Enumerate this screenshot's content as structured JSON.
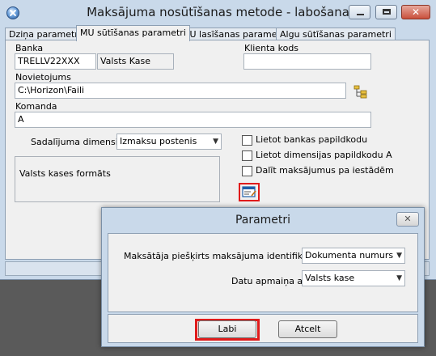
{
  "window": {
    "title": "Maksājuma nosūtīšanas metode - labošana",
    "minimize_label": "minimize",
    "maximize_label": "maximize",
    "close_glyph": "✕"
  },
  "tabs": [
    {
      "label": "Dziņa parametri"
    },
    {
      "label": "MU sūtīšanas parametri",
      "active": true
    },
    {
      "label": "MU lasīšanas parametri"
    },
    {
      "label": "Algu sūtīšanas parametri"
    }
  ],
  "form": {
    "bank_label": "Banka",
    "bank_code": "TRELLV22XXX",
    "bank_name": "Valsts Kase",
    "client_code_label": "Klienta kods",
    "client_code_value": "",
    "path_label": "Novietojums",
    "path_value": "C:\\Horizon\\Faili",
    "command_label": "Komanda",
    "command_value": "A",
    "dimension_label": "Sadalījuma dimensija:",
    "dimension_value": "Izmaksu postenis",
    "group_text": "Valsts kases formāts",
    "checkboxes": [
      {
        "label": "Lietot bankas papildkodu",
        "checked": false
      },
      {
        "label": "Lietot dimensijas papildkodu A",
        "checked": false
      },
      {
        "label": "Dalīt maksājumus pa iestādēm",
        "checked": false
      }
    ]
  },
  "icons": {
    "folder": "folder-tree-icon",
    "edit": "edit-parameters-icon",
    "app": "app-globe-icon"
  },
  "dialog": {
    "title": "Parametri",
    "close_glyph": "✕",
    "payer_id_label": "Maksātāja piešķirts maksājuma identifikators:",
    "payer_id_value": "Dokumenta numurs",
    "exchange_label": "Datu apmaiņa ar:",
    "exchange_value": "Valsts kase",
    "ok_label": "Labi",
    "cancel_label": "Atcelt"
  },
  "colors": {
    "highlight": "#e01b1b",
    "frame": "#c9d9ea"
  }
}
